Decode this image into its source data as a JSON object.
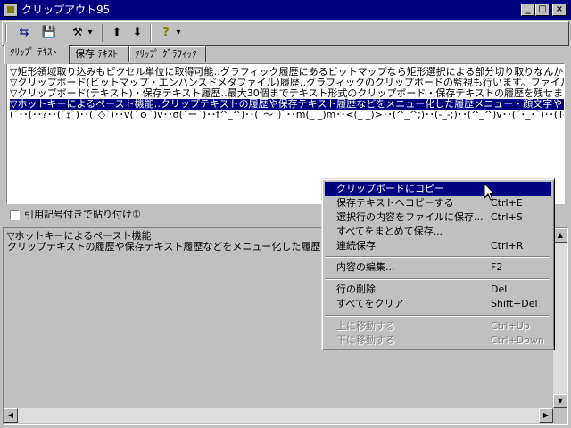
{
  "window": {
    "title": "クリップアウト95",
    "minimize_glyph": "_",
    "maximize_glyph": "□",
    "close_glyph": "×"
  },
  "toolbar": {
    "buttons": [
      {
        "name": "connect-button",
        "icon": "⇆"
      },
      {
        "name": "save-button",
        "icon": "💾"
      },
      {
        "name": "tools-button",
        "icon": "⚒"
      },
      {
        "name": "dropdown-arrow",
        "icon": "▾"
      },
      {
        "name": "up-button",
        "icon": "⬆"
      },
      {
        "name": "down-button",
        "icon": "⬇"
      },
      {
        "name": "help-button",
        "icon": "?"
      },
      {
        "name": "help-dropdown-arrow",
        "icon": "▾"
      }
    ]
  },
  "tabs": [
    {
      "label": "ｸﾘｯﾌﾟ ﾃｷｽﾄ",
      "active": true
    },
    {
      "label": "保存 ﾃｷｽﾄ",
      "active": false
    },
    {
      "label": "ｸﾘｯﾌﾟ ｸﾞﾗﾌｨｯｸ",
      "active": false
    }
  ],
  "list": {
    "rows": [
      "▽矩形領域取り込みもピクセル単位に取得可能‥グラフィック履歴にあるビットマップなら矩形選択による部分切り取りなんかも",
      "▽クリップボード(ビットマップ・エンハンスドメタファイル)履歴‥グラフィックのクリップボードの監視も行います。ファイル形式",
      "▽クリップボード(テキスト)・保存テキスト履歴‥最大30個までテキスト形式のクリップボード・保存テキストの履歴を残せます",
      "▽ホットキーによるペースト機能‥クリップテキストの履歴や保存テキスト履歴などをメニュー化した履歴メニュー・顔文字や",
      "(´･･(･･?･･(´ｪ`)･･(´◇`)･･v(´ｏ`)v･･σ(´ー`)･･f^_^)･･(¯～¯)ﾞ･･m(_ _)m･･<(_ _)>･･(^_^;)･･(-_-;)･･(^_^)v･･(´･_･`)･･(T-T)･･(>_<)･･p(^O^)q"
    ],
    "selected_index": 3
  },
  "options": {
    "quote_paste_label": "引用記号付きで貼り付け①"
  },
  "preview": {
    "line1": "▽ホットキーによるペースト機能",
    "line2": "クリップテキストの履歴や保存テキスト履歴などをメニュー化した履歴メ"
  },
  "context_menu": {
    "items": [
      {
        "label": "クリップボードにコピー",
        "shortcut": "",
        "state": "highlighted"
      },
      {
        "label": "保存テキストへコピーする",
        "shortcut": "Ctrl+E",
        "state": "normal"
      },
      {
        "label": "選択行の内容をファイルに保存...",
        "shortcut": "Ctrl+S",
        "state": "normal"
      },
      {
        "label": "すべてをまとめて保存...",
        "shortcut": "",
        "state": "normal"
      },
      {
        "label": "連続保存",
        "shortcut": "Ctrl+R",
        "state": "normal"
      },
      {
        "label": "内容の編集...",
        "shortcut": "F2",
        "state": "normal"
      },
      {
        "label": "行の削除",
        "shortcut": "Del",
        "state": "normal"
      },
      {
        "label": "すべてをクリア",
        "shortcut": "Shift+Del",
        "state": "normal"
      },
      {
        "label": "上に移動する",
        "shortcut": "Ctrl+Up",
        "state": "disabled"
      },
      {
        "label": "下に移動する",
        "shortcut": "Ctrl+Down",
        "state": "disabled"
      }
    ]
  },
  "colors": {
    "title_bar": "#000080",
    "selection": "#000080",
    "face": "#c0c0c0"
  }
}
